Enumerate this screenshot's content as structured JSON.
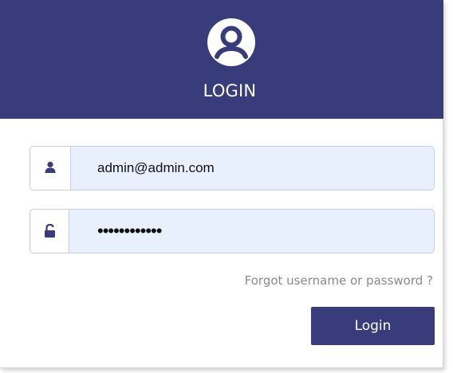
{
  "header": {
    "title": "LOGIN",
    "icon": "user-circle-icon",
    "background_color": "#383c7b"
  },
  "form": {
    "email": {
      "icon": "user-icon",
      "value": "admin@admin.com"
    },
    "password": {
      "icon": "unlock-icon",
      "value": "••••••••••••"
    },
    "forgot_link": "Forgot username or password ?",
    "submit_label": "Login",
    "field_background": "#e8f0fe"
  }
}
